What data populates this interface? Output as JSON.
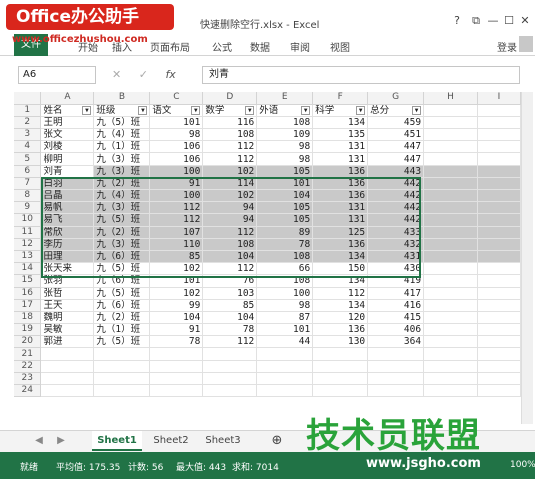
{
  "window": {
    "title": "快速删除空行.xlsx - Excel",
    "help": "?",
    "restore": "⧉",
    "minimize": "—",
    "maximize": "☐",
    "close": "✕"
  },
  "watermark": {
    "text": "Office办公助手",
    "url": "www.officezhushou.com"
  },
  "ribbon": {
    "file_tab": "文件",
    "tabs": [
      "开始",
      "插入",
      "页面布局",
      "公式",
      "数据",
      "审阅",
      "视图"
    ],
    "account": "登录"
  },
  "formula_bar": {
    "name_box": "A6",
    "cancel": "✕",
    "enter": "✓",
    "fx": "fx",
    "value": "刘青"
  },
  "columns": [
    "A",
    "B",
    "C",
    "D",
    "E",
    "F",
    "G",
    "H",
    "I"
  ],
  "header_row": [
    "姓名",
    "班级",
    "语文",
    "数学",
    "外语",
    "科学",
    "总分"
  ],
  "rows": [
    [
      "王明",
      "九（5）班",
      "101",
      "116",
      "108",
      "134",
      "459"
    ],
    [
      "张文",
      "九（4）班",
      "98",
      "108",
      "109",
      "135",
      "451"
    ],
    [
      "刘棱",
      "九（1）班",
      "106",
      "112",
      "98",
      "131",
      "447"
    ],
    [
      "柳明",
      "九（3）班",
      "106",
      "112",
      "98",
      "131",
      "447"
    ],
    [
      "刘青",
      "九（3）班",
      "100",
      "102",
      "105",
      "136",
      "443"
    ],
    [
      "白羽",
      "九（2）班",
      "91",
      "114",
      "101",
      "136",
      "442"
    ],
    [
      "吕晶",
      "九（4）班",
      "100",
      "102",
      "104",
      "136",
      "442"
    ],
    [
      "易帆",
      "九（3）班",
      "112",
      "94",
      "105",
      "131",
      "442"
    ],
    [
      "易飞",
      "九（5）班",
      "112",
      "94",
      "105",
      "131",
      "442"
    ],
    [
      "常欣",
      "九（2）班",
      "107",
      "112",
      "89",
      "125",
      "433"
    ],
    [
      "李历",
      "九（3）班",
      "110",
      "108",
      "78",
      "136",
      "432"
    ],
    [
      "田理",
      "九（6）班",
      "85",
      "104",
      "108",
      "134",
      "431"
    ],
    [
      "张天来",
      "九（5）班",
      "102",
      "112",
      "66",
      "150",
      "430"
    ],
    [
      "张羽",
      "九（6）班",
      "101",
      "76",
      "108",
      "134",
      "419"
    ],
    [
      "张哲",
      "九（5）班",
      "102",
      "103",
      "100",
      "112",
      "417"
    ],
    [
      "王天",
      "九（6）班",
      "99",
      "85",
      "98",
      "134",
      "416"
    ],
    [
      "魏明",
      "九（2）班",
      "104",
      "104",
      "87",
      "120",
      "415"
    ],
    [
      "吴敏",
      "九（1）班",
      "91",
      "78",
      "101",
      "136",
      "406"
    ],
    [
      "郭进",
      "九（5）班",
      "78",
      "112",
      "44",
      "130",
      "364"
    ]
  ],
  "row_numbers": [
    "1",
    "2",
    "3",
    "4",
    "5",
    "6",
    "7",
    "8",
    "9",
    "10",
    "11",
    "12",
    "13",
    "14",
    "15",
    "16",
    "17",
    "18",
    "19",
    "20",
    "21",
    "22",
    "23",
    "24"
  ],
  "sheet_tabs": [
    "Sheet1",
    "Sheet2",
    "Sheet3"
  ],
  "add_sheet": "⊕",
  "status": {
    "mode": "就绪",
    "average": "平均值: 175.35",
    "count": "计数: 56",
    "max": "最大值: 443",
    "sum": "求和: 7014",
    "zoom": "100%"
  },
  "logo2": {
    "text": "技术员联盟",
    "url": "www.jsgho.com"
  },
  "colors": {
    "accent": "#217346",
    "selection": "#c9c9c9",
    "watermark_red": "#d9261c",
    "logo_green": "#2aa33a"
  }
}
